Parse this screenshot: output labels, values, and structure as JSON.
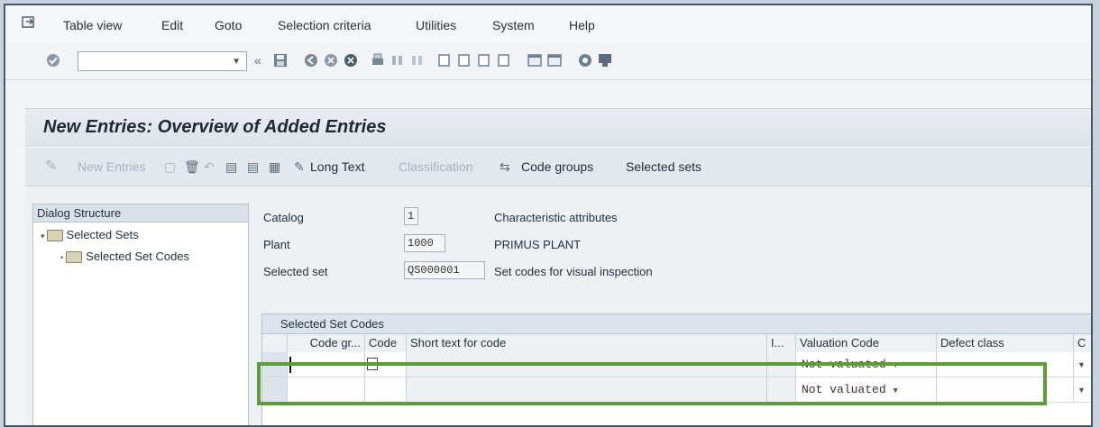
{
  "menu": {
    "items": [
      "Table view",
      "Edit",
      "Goto",
      "Selection criteria",
      "Utilities",
      "System",
      "Help"
    ]
  },
  "toolbar": {
    "command_value": "",
    "icons": [
      "check-icon",
      "back-icon",
      "save-icon",
      "exit-icon",
      "cancel-icon",
      "print-icon",
      "find-icon",
      "find-next-icon",
      "first-page-icon",
      "prev-page-icon",
      "next-page-icon",
      "last-page-icon",
      "create-session-icon",
      "shortcut-icon",
      "help-icon",
      "customize-icon"
    ]
  },
  "screen": {
    "title": "New Entries: Overview of Added Entries"
  },
  "app_toolbar": {
    "new_entries": "New Entries",
    "long_text": "Long Text",
    "classification": "Classification",
    "code_groups": "Code groups",
    "selected_sets": "Selected sets"
  },
  "tree": {
    "header": "Dialog Structure",
    "nodes": [
      "Selected Sets",
      "Selected Set Codes"
    ]
  },
  "fields": {
    "catalog": {
      "label": "Catalog",
      "value": "1",
      "desc": "Characteristic attributes"
    },
    "plant": {
      "label": "Plant",
      "value": "1000",
      "desc": "PRIMUS PLANT"
    },
    "selected_set": {
      "label": "Selected set",
      "value": "QS000001",
      "desc": "Set codes for visual inspection"
    }
  },
  "table": {
    "caption": "Selected Set Codes",
    "headers": [
      "Code gr...",
      "Code",
      "Short text for code",
      "I...",
      "Valuation Code",
      "Defect class",
      "C"
    ],
    "rows": [
      {
        "code_group": "",
        "code": "",
        "short_text": "",
        "valuation": "Not valuated",
        "defect": ""
      },
      {
        "code_group": "",
        "code": "",
        "short_text": "",
        "valuation": "Not valuated",
        "defect": ""
      }
    ]
  },
  "colors": {
    "highlight": "#5f9b3a",
    "title_bg": "#e4e9ef"
  }
}
